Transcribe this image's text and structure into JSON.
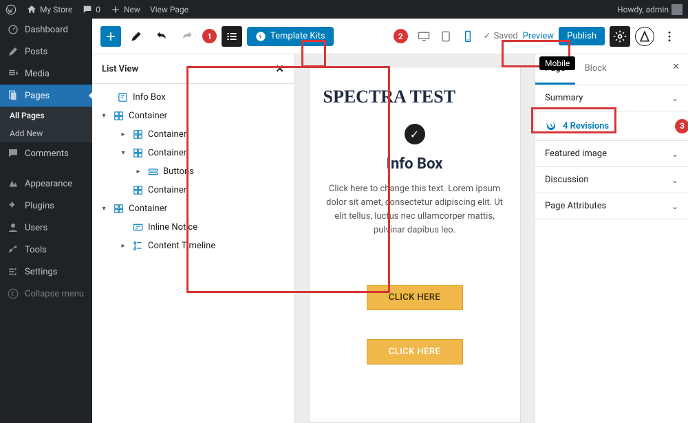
{
  "adminbar": {
    "site": "My Store",
    "comments": "0",
    "new": "New",
    "view": "View Page",
    "howdy": "Howdy, admin"
  },
  "menu": {
    "dashboard": "Dashboard",
    "posts": "Posts",
    "media": "Media",
    "pages": "Pages",
    "pages_sub_all": "All Pages",
    "pages_sub_add": "Add New",
    "comments": "Comments",
    "appearance": "Appearance",
    "plugins": "Plugins",
    "users": "Users",
    "tools": "Tools",
    "settings": "Settings",
    "collapse": "Collapse menu"
  },
  "toolbar": {
    "template_kits": "Template Kits",
    "saved": "Saved",
    "preview": "Preview",
    "publish": "Publish"
  },
  "badges": {
    "one": "1",
    "two": "2",
    "three": "3"
  },
  "tooltip": {
    "mobile": "Mobile"
  },
  "listview": {
    "title": "List View",
    "items": {
      "infobox": "Info Box",
      "container": "Container",
      "buttons": "Buttons",
      "inline": "Inline Notice",
      "timeline": "Content Timeline"
    }
  },
  "canvas": {
    "h1": "SPECTRA TEST",
    "infobox_title": "Info Box",
    "infobox_text": "Click here to change this text. Lorem ipsum dolor sit amet, consectetur adipiscing elit. Ut elit tellus, luctus nec ullamcorper mattis, pulvinar dapibus leo.",
    "cta": "CLICK HERE"
  },
  "sidebar": {
    "tab_page": "Page",
    "tab_block": "Block",
    "summary": "Summary",
    "revisions": "4 Revisions",
    "featured": "Featured image",
    "discussion": "Discussion",
    "attrs": "Page Attributes"
  }
}
